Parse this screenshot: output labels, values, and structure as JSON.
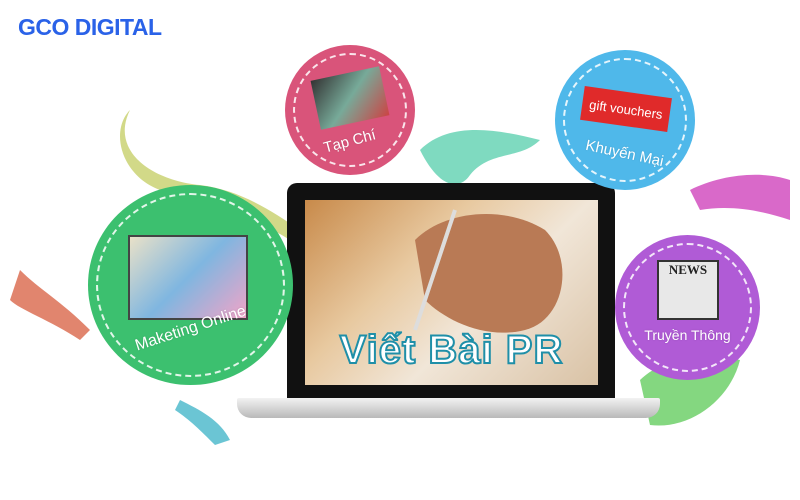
{
  "brand": {
    "logo": "GCO DIGITAL",
    "color": "#2a62e8"
  },
  "headline": "Viết Bài PR",
  "bubbles": [
    {
      "label": "Tạp Chí",
      "color": "#d9547a",
      "icon": "magazines-icon"
    },
    {
      "label": "Khuyến Mại",
      "color": "#4fb8ea",
      "icon": "gift-voucher-icon",
      "voucher_text": "gift vouchers"
    },
    {
      "label": "Maketing Online",
      "color": "#3cc06f",
      "icon": "websites-icon"
    },
    {
      "label": "Truyền Thông",
      "color": "#b05bd6",
      "icon": "newspaper-icon",
      "news_text": "NEWS"
    }
  ]
}
